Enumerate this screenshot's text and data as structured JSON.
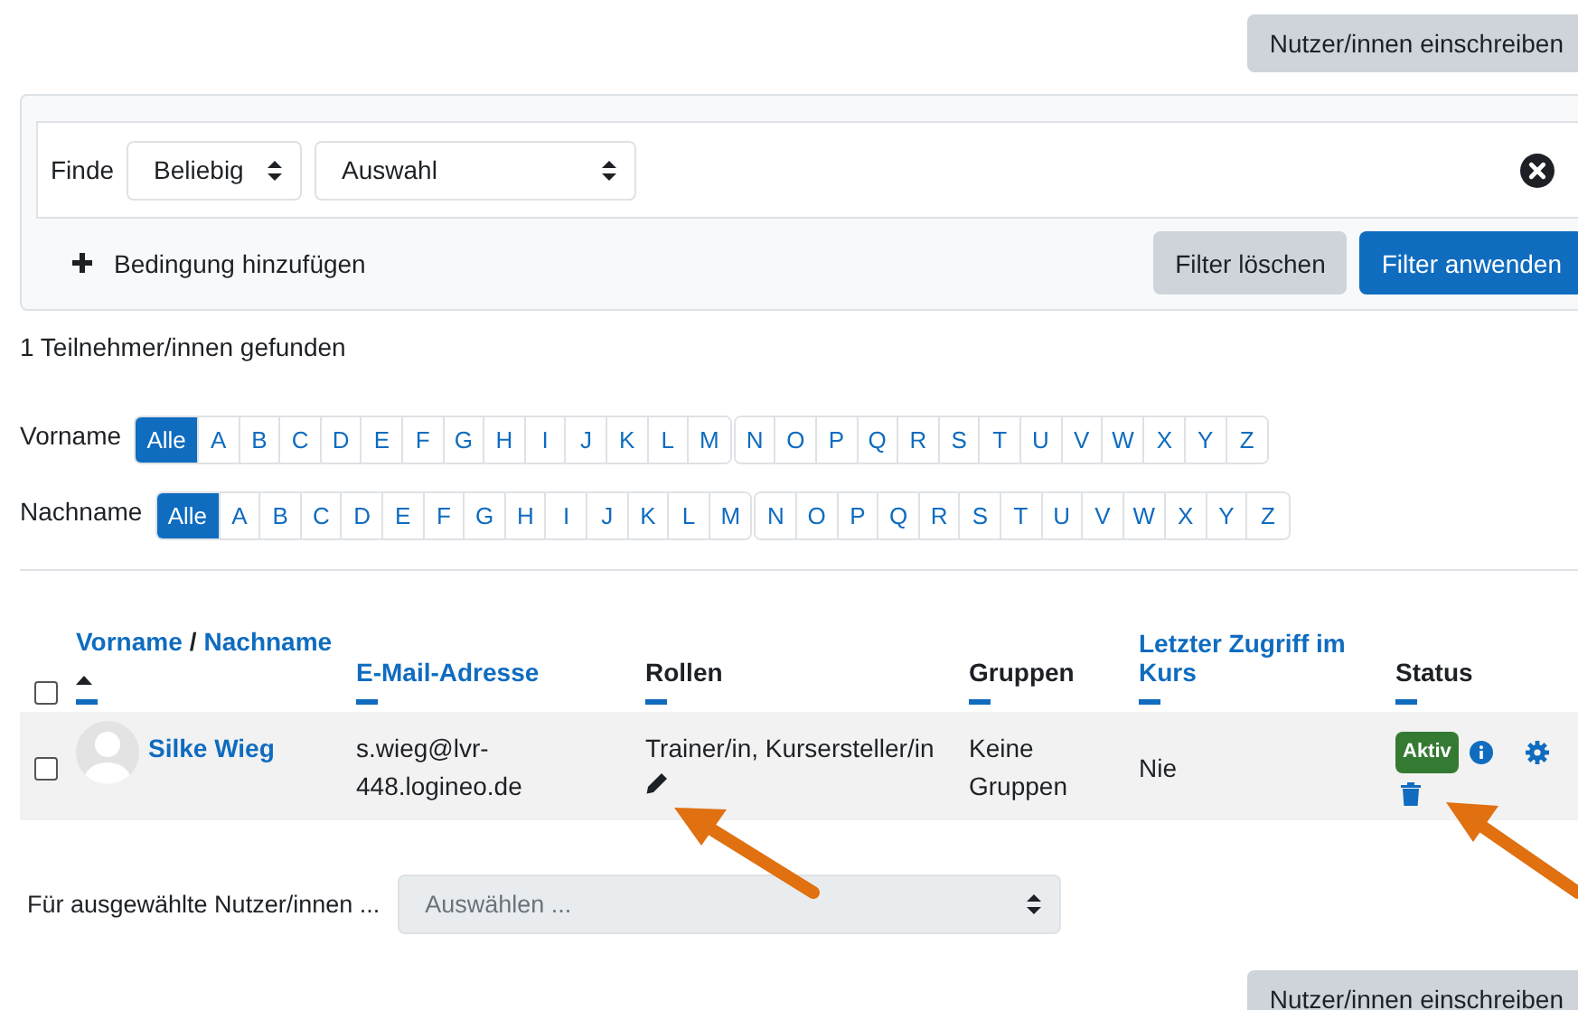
{
  "enrol_button_top": "Nutzer/innen einschreiben",
  "filter": {
    "match_label": "Finde",
    "match": "Beliebig",
    "condition": "Auswahl",
    "add_label": "Bedingung hinzufügen",
    "clear": "Filter löschen",
    "apply": "Filter anwenden"
  },
  "found": "1 Teilnehmer/innen gefunden",
  "initials_bars": [
    {
      "label": "Vorname",
      "groups": [
        [
          {
            "text": "Alle",
            "selected": true
          },
          {
            "text": "A",
            "selected": false
          },
          {
            "text": "B",
            "selected": false
          },
          {
            "text": "C",
            "selected": false
          },
          {
            "text": "D",
            "selected": false
          },
          {
            "text": "E",
            "selected": false
          },
          {
            "text": "F",
            "selected": false
          },
          {
            "text": "G",
            "selected": false
          },
          {
            "text": "H",
            "selected": false
          },
          {
            "text": "I",
            "selected": false
          },
          {
            "text": "J",
            "selected": false
          },
          {
            "text": "K",
            "selected": false
          },
          {
            "text": "L",
            "selected": false
          },
          {
            "text": "M",
            "selected": false
          }
        ],
        [
          {
            "text": "N",
            "selected": false
          },
          {
            "text": "O",
            "selected": false
          },
          {
            "text": "P",
            "selected": false
          },
          {
            "text": "Q",
            "selected": false
          },
          {
            "text": "R",
            "selected": false
          },
          {
            "text": "S",
            "selected": false
          },
          {
            "text": "T",
            "selected": false
          },
          {
            "text": "U",
            "selected": false
          },
          {
            "text": "V",
            "selected": false
          },
          {
            "text": "W",
            "selected": false
          },
          {
            "text": "X",
            "selected": false
          },
          {
            "text": "Y",
            "selected": false
          },
          {
            "text": "Z",
            "selected": false
          }
        ]
      ]
    },
    {
      "label": "Nachname",
      "groups": [
        [
          {
            "text": "Alle",
            "selected": true
          },
          {
            "text": "A",
            "selected": false
          },
          {
            "text": "B",
            "selected": false
          },
          {
            "text": "C",
            "selected": false
          },
          {
            "text": "D",
            "selected": false
          },
          {
            "text": "E",
            "selected": false
          },
          {
            "text": "F",
            "selected": false
          },
          {
            "text": "G",
            "selected": false
          },
          {
            "text": "H",
            "selected": false
          },
          {
            "text": "I",
            "selected": false
          },
          {
            "text": "J",
            "selected": false
          },
          {
            "text": "K",
            "selected": false
          },
          {
            "text": "L",
            "selected": false
          },
          {
            "text": "M",
            "selected": false
          }
        ],
        [
          {
            "text": "N",
            "selected": false
          },
          {
            "text": "O",
            "selected": false
          },
          {
            "text": "P",
            "selected": false
          },
          {
            "text": "Q",
            "selected": false
          },
          {
            "text": "R",
            "selected": false
          },
          {
            "text": "S",
            "selected": false
          },
          {
            "text": "T",
            "selected": false
          },
          {
            "text": "U",
            "selected": false
          },
          {
            "text": "V",
            "selected": false
          },
          {
            "text": "W",
            "selected": false
          },
          {
            "text": "X",
            "selected": false
          },
          {
            "text": "Y",
            "selected": false
          },
          {
            "text": "Z",
            "selected": false
          }
        ]
      ]
    }
  ],
  "table": {
    "select_all": {
      "checked": false
    },
    "columns": [
      {
        "kind": "name",
        "labels": [
          "Vorname",
          "Nachname"
        ],
        "separator": "/",
        "sorted": true
      },
      {
        "kind": "link",
        "label": "E-Mail-Adresse"
      },
      {
        "kind": "plain",
        "label": "Rollen"
      },
      {
        "kind": "plain",
        "label": "Gruppen"
      },
      {
        "kind": "link",
        "label": "Letzter Zugriff im Kurs"
      },
      {
        "kind": "plain",
        "label": "Status"
      }
    ],
    "rows": [
      {
        "checked": false,
        "name": "Silke Wieg",
        "email": "s.wieg@lvr-448.logineo.de",
        "roles": "Trainer/in, Kursersteller/in",
        "groups": "Keine Gruppen",
        "last_access": "Nie",
        "status": "Aktiv"
      }
    ]
  },
  "bulk": {
    "label": "Für ausgewählte Nutzer/innen ...",
    "placeholder": "Auswählen ..."
  },
  "enrol_button_bottom": "Nutzer/innen einschreiben"
}
